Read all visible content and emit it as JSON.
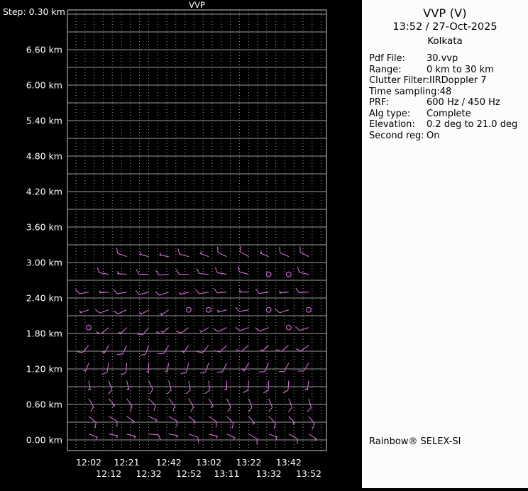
{
  "panel": {
    "title": "VVP (V)",
    "datetime": "13:52 / 27-Oct-2025",
    "station": "Kolkata",
    "fields": [
      {
        "label": "Pdf File:",
        "value": "30.vvp"
      },
      {
        "label": "Range:",
        "value": "0 km to 30 km"
      },
      {
        "label": "Clutter Filter:",
        "value": "IIRDoppler 7"
      },
      {
        "label": "Time sampling:",
        "value": "48"
      },
      {
        "label": "PRF:",
        "value": "600 Hz / 450 Hz"
      },
      {
        "label": "Alg type:",
        "value": "Complete"
      },
      {
        "label": "Elevation:",
        "value": "0.2 deg to 21.0 deg"
      },
      {
        "label": "Second reg:",
        "value": "On"
      }
    ],
    "footer": "Rainbow® SELEX-SI"
  },
  "chart_data": {
    "type": "wind-barb-profile",
    "title": "VVP",
    "step_label": "Step: 0.30 km",
    "y_axis_unit": "km",
    "height_range_km": [
      0.0,
      7.2
    ],
    "step_km": 0.3,
    "grid": true,
    "colors": {
      "background": "#000000",
      "axis_text": "#ffffff",
      "grid_line": "#9a9a9a",
      "border": "#c8c8c8",
      "barb": "#d46ed4"
    },
    "y_ticks": [
      {
        "km": 6.6,
        "label": "6.60 km"
      },
      {
        "km": 6.0,
        "label": "6.00 km"
      },
      {
        "km": 5.4,
        "label": "5.40 km"
      },
      {
        "km": 4.8,
        "label": "4.80 km"
      },
      {
        "km": 4.2,
        "label": "4.20 km"
      },
      {
        "km": 3.6,
        "label": "3.60 km"
      },
      {
        "km": 3.0,
        "label": "3.00 km"
      },
      {
        "km": 2.4,
        "label": "2.40 km"
      },
      {
        "km": 1.8,
        "label": "1.80 km"
      },
      {
        "km": 1.2,
        "label": "1.20 km"
      },
      {
        "km": 0.6,
        "label": "0.60 km"
      },
      {
        "km": 0.0,
        "label": "0.00 km"
      }
    ],
    "times": [
      "12:02",
      "12:12",
      "12:21",
      "12:32",
      "12:42",
      "12:52",
      "13:02",
      "13:11",
      "13:22",
      "13:32",
      "13:42",
      "13:52"
    ],
    "x_tick_rows": [
      [
        "12:02",
        "12:21",
        "12:42",
        "13:02",
        "13:22",
        "13:42"
      ],
      [
        "12:12",
        "12:32",
        "12:52",
        "13:11",
        "13:32",
        "13:52"
      ]
    ],
    "barb_note": "entries are [time_index, height_km, wind_from_deg, speed_kt]; speed 0 = calm (circle)",
    "barbs": [
      [
        0,
        0.1,
        110,
        5
      ],
      [
        0,
        0.4,
        130,
        10
      ],
      [
        0,
        0.7,
        150,
        10
      ],
      [
        0,
        1.0,
        170,
        5
      ],
      [
        0,
        1.3,
        200,
        5
      ],
      [
        0,
        1.6,
        220,
        10
      ],
      [
        0,
        1.9,
        0,
        0
      ],
      [
        0,
        2.2,
        250,
        5
      ],
      [
        0,
        2.5,
        260,
        10
      ],
      [
        1,
        0.1,
        100,
        5
      ],
      [
        1,
        0.4,
        120,
        10
      ],
      [
        1,
        0.7,
        140,
        5
      ],
      [
        1,
        1.0,
        160,
        10
      ],
      [
        1,
        1.3,
        190,
        10
      ],
      [
        1,
        1.6,
        210,
        5
      ],
      [
        1,
        1.9,
        230,
        10
      ],
      [
        1,
        2.2,
        250,
        10
      ],
      [
        1,
        2.5,
        265,
        5
      ],
      [
        1,
        2.8,
        280,
        10
      ],
      [
        2,
        0.1,
        105,
        5
      ],
      [
        2,
        0.4,
        125,
        5
      ],
      [
        2,
        0.7,
        145,
        10
      ],
      [
        2,
        1.0,
        165,
        5
      ],
      [
        2,
        1.3,
        185,
        10
      ],
      [
        2,
        1.6,
        205,
        10
      ],
      [
        2,
        1.9,
        225,
        5
      ],
      [
        2,
        2.2,
        245,
        10
      ],
      [
        2,
        2.5,
        260,
        10
      ],
      [
        2,
        2.8,
        275,
        5
      ],
      [
        2,
        3.1,
        290,
        10
      ],
      [
        3,
        0.1,
        95,
        10
      ],
      [
        3,
        0.4,
        115,
        5
      ],
      [
        3,
        0.7,
        135,
        10
      ],
      [
        3,
        1.0,
        155,
        10
      ],
      [
        3,
        1.3,
        180,
        5
      ],
      [
        3,
        1.6,
        200,
        10
      ],
      [
        3,
        1.9,
        220,
        10
      ],
      [
        3,
        2.2,
        240,
        5
      ],
      [
        3,
        2.5,
        255,
        10
      ],
      [
        3,
        2.8,
        270,
        10
      ],
      [
        3,
        3.1,
        285,
        5
      ],
      [
        4,
        0.1,
        100,
        5
      ],
      [
        4,
        0.4,
        120,
        10
      ],
      [
        4,
        0.7,
        140,
        10
      ],
      [
        4,
        1.0,
        165,
        10
      ],
      [
        4,
        1.3,
        190,
        5
      ],
      [
        4,
        1.6,
        210,
        10
      ],
      [
        4,
        1.9,
        230,
        15
      ],
      [
        4,
        2.2,
        235,
        5
      ],
      [
        4,
        2.5,
        250,
        10
      ],
      [
        4,
        2.8,
        265,
        10
      ],
      [
        4,
        3.1,
        280,
        5
      ],
      [
        5,
        0.1,
        110,
        10
      ],
      [
        5,
        0.4,
        130,
        5
      ],
      [
        5,
        0.7,
        150,
        10
      ],
      [
        5,
        1.0,
        170,
        10
      ],
      [
        5,
        1.3,
        195,
        10
      ],
      [
        5,
        1.6,
        215,
        5
      ],
      [
        5,
        1.9,
        235,
        10
      ],
      [
        5,
        2.2,
        0,
        0
      ],
      [
        5,
        2.5,
        255,
        5
      ],
      [
        5,
        2.8,
        270,
        10
      ],
      [
        5,
        3.1,
        285,
        10
      ],
      [
        6,
        0.1,
        105,
        5
      ],
      [
        6,
        0.4,
        125,
        10
      ],
      [
        6,
        0.7,
        150,
        5
      ],
      [
        6,
        1.0,
        175,
        10
      ],
      [
        6,
        1.3,
        200,
        10
      ],
      [
        6,
        1.6,
        220,
        10
      ],
      [
        6,
        1.9,
        240,
        5
      ],
      [
        6,
        2.2,
        0,
        0
      ],
      [
        6,
        2.5,
        260,
        10
      ],
      [
        6,
        2.8,
        275,
        10
      ],
      [
        6,
        3.1,
        290,
        5
      ],
      [
        7,
        0.1,
        115,
        5
      ],
      [
        7,
        0.4,
        135,
        10
      ],
      [
        7,
        0.7,
        155,
        10
      ],
      [
        7,
        1.0,
        180,
        5
      ],
      [
        7,
        1.3,
        205,
        10
      ],
      [
        7,
        1.6,
        225,
        10
      ],
      [
        7,
        1.9,
        245,
        10
      ],
      [
        7,
        2.2,
        255,
        5
      ],
      [
        7,
        2.5,
        265,
        10
      ],
      [
        7,
        2.8,
        280,
        10
      ],
      [
        7,
        3.1,
        295,
        10
      ],
      [
        8,
        0.1,
        120,
        10
      ],
      [
        8,
        0.4,
        140,
        5
      ],
      [
        8,
        0.7,
        160,
        10
      ],
      [
        8,
        1.0,
        185,
        10
      ],
      [
        8,
        1.3,
        210,
        5
      ],
      [
        8,
        1.6,
        230,
        10
      ],
      [
        8,
        1.9,
        250,
        10
      ],
      [
        8,
        2.2,
        260,
        10
      ],
      [
        8,
        2.5,
        270,
        5
      ],
      [
        8,
        2.8,
        285,
        10
      ],
      [
        8,
        3.1,
        300,
        10
      ],
      [
        9,
        0.1,
        110,
        5
      ],
      [
        9,
        0.4,
        135,
        10
      ],
      [
        9,
        0.7,
        158,
        10
      ],
      [
        9,
        1.0,
        182,
        10
      ],
      [
        9,
        1.3,
        206,
        10
      ],
      [
        9,
        1.6,
        228,
        5
      ],
      [
        9,
        1.9,
        248,
        10
      ],
      [
        9,
        2.2,
        0,
        0
      ],
      [
        9,
        2.5,
        262,
        10
      ],
      [
        9,
        2.8,
        0,
        0
      ],
      [
        9,
        3.1,
        292,
        5
      ],
      [
        10,
        0.1,
        118,
        10
      ],
      [
        10,
        0.4,
        138,
        5
      ],
      [
        10,
        0.7,
        160,
        10
      ],
      [
        10,
        1.0,
        184,
        10
      ],
      [
        10,
        1.3,
        208,
        10
      ],
      [
        10,
        1.6,
        230,
        10
      ],
      [
        10,
        1.9,
        0,
        0
      ],
      [
        10,
        2.2,
        252,
        10
      ],
      [
        10,
        2.5,
        264,
        5
      ],
      [
        10,
        2.8,
        0,
        0
      ],
      [
        10,
        3.1,
        295,
        10
      ],
      [
        11,
        0.1,
        122,
        5
      ],
      [
        11,
        0.4,
        142,
        10
      ],
      [
        11,
        0.7,
        165,
        10
      ],
      [
        11,
        1.0,
        188,
        5
      ],
      [
        11,
        1.3,
        212,
        10
      ],
      [
        11,
        1.6,
        234,
        10
      ],
      [
        11,
        1.9,
        252,
        10
      ],
      [
        11,
        2.2,
        0,
        0
      ],
      [
        11,
        2.5,
        266,
        10
      ],
      [
        11,
        2.8,
        282,
        10
      ],
      [
        11,
        3.1,
        298,
        10
      ]
    ]
  }
}
